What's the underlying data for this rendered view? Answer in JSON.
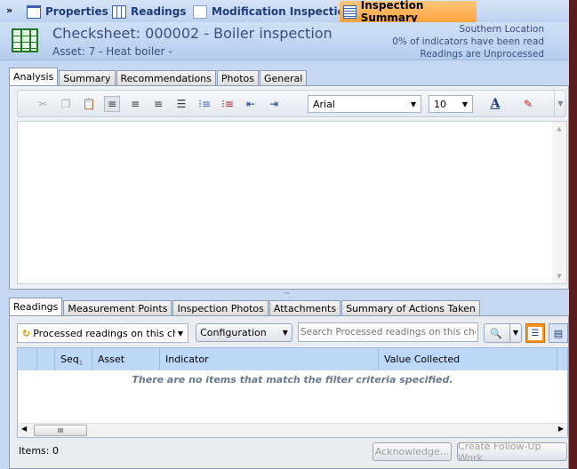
{
  "top_tabs": [
    "Properties",
    "Readings",
    "Modification Inspection",
    "Inspection Summary"
  ],
  "header": {
    "title": "Checksheet: 000002 - Boiler inspection",
    "asset": "Asset: 7 - Heat boiler -",
    "location": "Southern Location",
    "indicators": "0% of indicators  have been read",
    "status": "Readings are Unprocessed"
  },
  "editor_tabs": [
    "Analysis",
    "Summary",
    "Recommendations",
    "Photos",
    "General"
  ],
  "toolbar": {
    "font": "Arial",
    "size": "10"
  },
  "bottom_tabs": [
    "Readings",
    "Measurement Points",
    "Inspection Photos",
    "Attachments",
    "Summary of Actions Taken"
  ],
  "filter": {
    "selected": "Processed readings on this chec",
    "configuration": "Configuration",
    "search_placeholder": "Search Processed readings on this checks"
  },
  "grid": {
    "columns": [
      "",
      "",
      "Seq",
      "Asset",
      "Indicator",
      "Value Collected"
    ],
    "sort_indicator": "1",
    "empty": "There are no items that match the filter criteria specified."
  },
  "footer": {
    "items": "Items: 0",
    "acknowledge": "Acknowledge...",
    "followup": "Create Follow-Up Work"
  },
  "colors": {
    "accent": "#f8a33c",
    "header_text": "#3a4e7a"
  }
}
